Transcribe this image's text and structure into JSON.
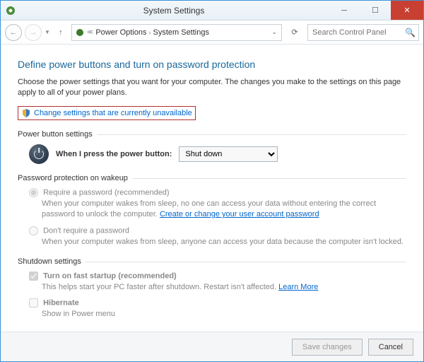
{
  "window": {
    "title": "System Settings"
  },
  "breadcrumb": {
    "level1": "Power Options",
    "level2": "System Settings"
  },
  "search": {
    "placeholder": "Search Control Panel"
  },
  "heading": "Define power buttons and turn on password protection",
  "description": "Choose the power settings that you want for your computer. The changes you make to the settings on this page apply to all of your power plans.",
  "change_link": "Change settings that are currently unavailable",
  "sections": {
    "power_button": {
      "title": "Power button settings",
      "label": "When I press the power button:",
      "selected": "Shut down"
    },
    "password": {
      "title": "Password protection on wakeup",
      "opt1_label": "Require a password (recommended)",
      "opt1_desc_a": "When your computer wakes from sleep, no one can access your data without entering the correct password to unlock the computer. ",
      "opt1_link": "Create or change your user account password",
      "opt2_label": "Don't require a password",
      "opt2_desc": "When your computer wakes from sleep, anyone can access your data because the computer isn't locked."
    },
    "shutdown": {
      "title": "Shutdown settings",
      "fast_label": "Turn on fast startup (recommended)",
      "fast_desc": "This helps start your PC faster after shutdown. Restart isn't affected. ",
      "fast_link": "Learn More",
      "hibernate_label": "Hibernate",
      "hibernate_desc": "Show in Power menu"
    }
  },
  "footer": {
    "save": "Save changes",
    "cancel": "Cancel"
  }
}
